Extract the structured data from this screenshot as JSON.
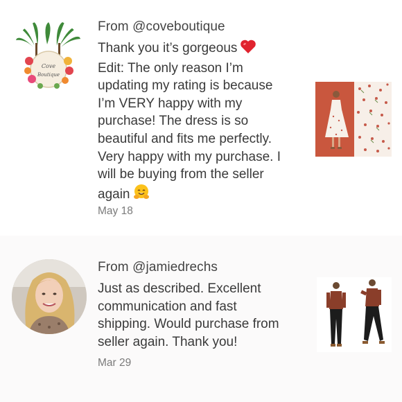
{
  "reviews": [
    {
      "from": "From @coveboutique",
      "lines": [
        "Thank you it’s gorgeous",
        "Edit: The only reason I’m",
        "updating my rating is because",
        "I’m VERY happy with my",
        "purchase! The dress is so",
        "beautiful and fits me perfectly.",
        "Very happy with my purchase. I",
        "will be buying from the seller",
        "again"
      ],
      "date": "May 18",
      "avatar_logo_text": "Cove Boutique",
      "emojis": [
        "red-heart-emoji",
        "hugging-face-emoji"
      ]
    },
    {
      "from": "From @jamiedrechs",
      "lines": [
        "Just as described. Excellent",
        "communication and fast",
        "shipping. Would purchase from",
        "seller again. Thank you!"
      ],
      "date": "Mar 29"
    }
  ],
  "colors": {
    "text": "#3a3a3a",
    "date": "#7a7a7a",
    "photo_bg_rust": "#c9573e",
    "second_review_bg": "#fbfafa"
  }
}
